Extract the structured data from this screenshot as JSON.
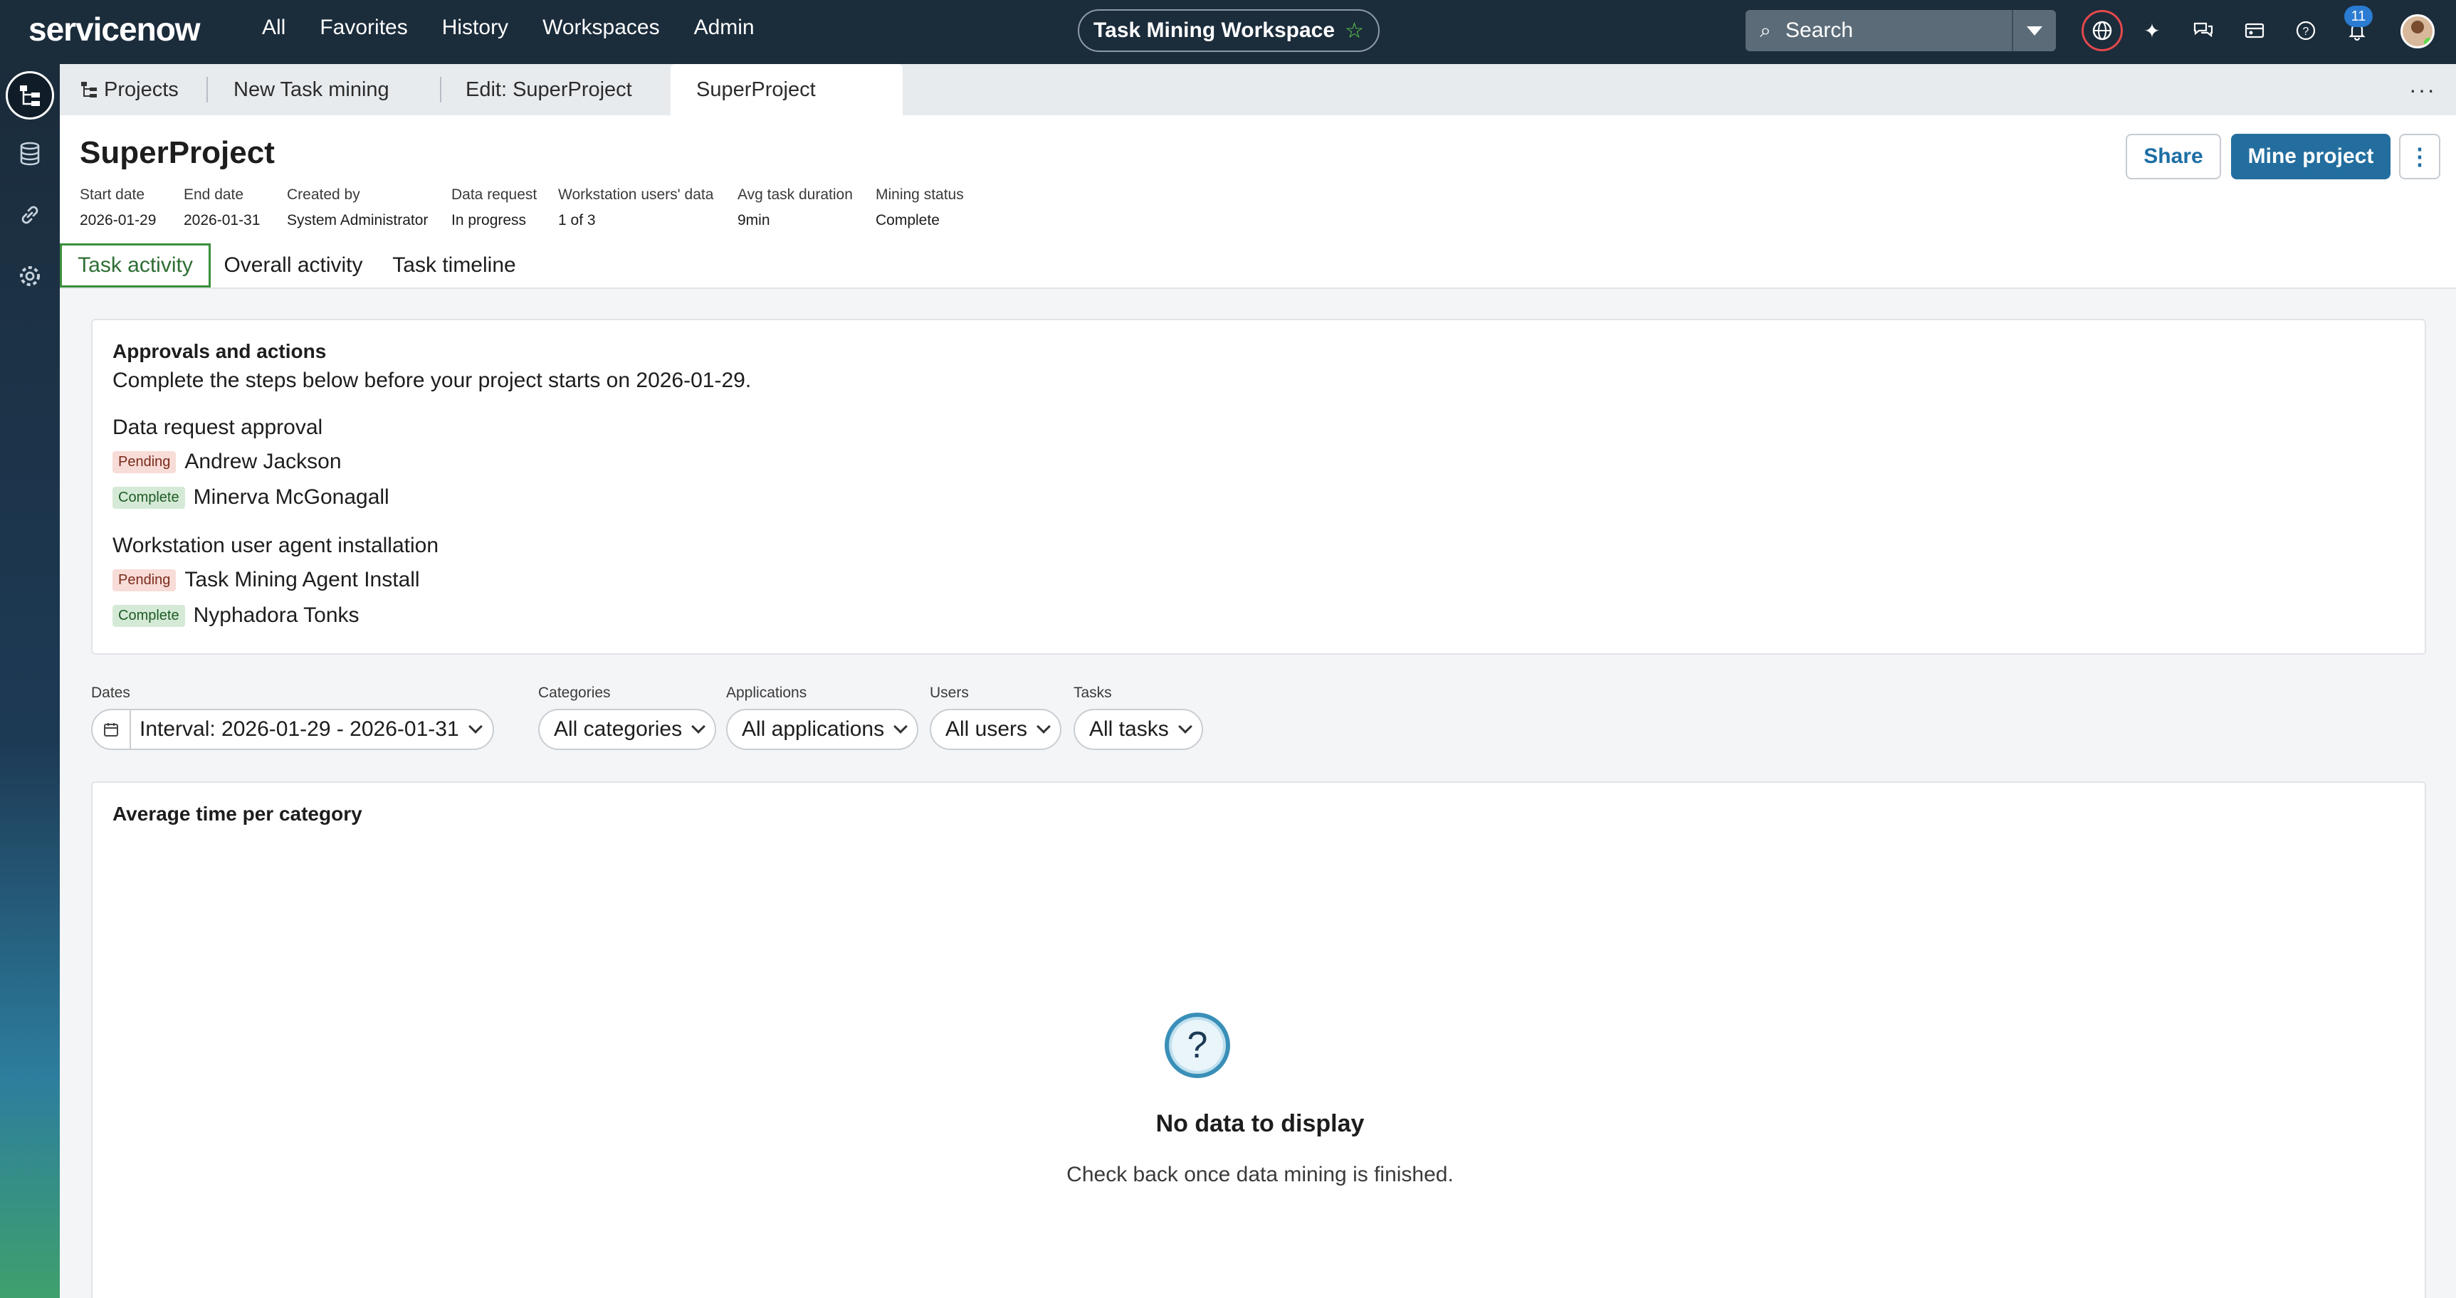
{
  "brand": {
    "logo": "servicenow"
  },
  "nav": {
    "menu": [
      "All",
      "Favorites",
      "History",
      "Workspaces",
      "Admin"
    ],
    "workspace_title": "Task Mining Workspace",
    "search_placeholder": "Search",
    "notifications_count": "11"
  },
  "tabs": [
    {
      "label": "Projects"
    },
    {
      "label": "New Task mining"
    },
    {
      "label": "Edit: SuperProject"
    },
    {
      "label": "SuperProject"
    }
  ],
  "project": {
    "title": "SuperProject",
    "meta": [
      {
        "label": "Start date",
        "value": "2026-01-29"
      },
      {
        "label": "End date",
        "value": "2026-01-31"
      },
      {
        "label": "Created by",
        "value": "System Administrator"
      },
      {
        "label": "Data request",
        "value": "In progress"
      },
      {
        "label": "Workstation users' data",
        "value": "1 of 3"
      },
      {
        "label": "Avg task duration",
        "value": "9min"
      },
      {
        "label": "Mining status",
        "value": "Complete"
      }
    ],
    "actions": {
      "share": "Share",
      "mine": "Mine project"
    }
  },
  "subtabs": [
    "Task activity",
    "Overall activity",
    "Task timeline"
  ],
  "approvals": {
    "title": "Approvals and actions",
    "description": "Complete the steps below before your project starts on 2026-01-29.",
    "sections": [
      {
        "heading": "Data request approval",
        "items": [
          {
            "status": "Pending",
            "name": "Andrew Jackson"
          },
          {
            "status": "Complete",
            "name": "Minerva McGonagall"
          }
        ]
      },
      {
        "heading": "Workstation user agent installation",
        "items": [
          {
            "status": "Pending",
            "name": "Task Mining Agent Install"
          },
          {
            "status": "Complete",
            "name": "Nyphadora Tonks"
          }
        ]
      }
    ]
  },
  "filters": [
    {
      "label": "Dates",
      "value": "Interval: 2026-01-29 - 2026-01-31"
    },
    {
      "label": "Categories",
      "value": "All categories"
    },
    {
      "label": "Applications",
      "value": "All applications"
    },
    {
      "label": "Users",
      "value": "All users"
    },
    {
      "label": "Tasks",
      "value": "All tasks"
    }
  ],
  "chart_card": {
    "title": "Average time per category",
    "empty_title": "No data to display",
    "empty_text": "Check back once data mining is finished."
  },
  "colors": {
    "accent": "#236e9e",
    "brand_green": "#62d84e",
    "nav_bg": "#1b2c3b",
    "active_tab_border": "#3a8f3c"
  }
}
